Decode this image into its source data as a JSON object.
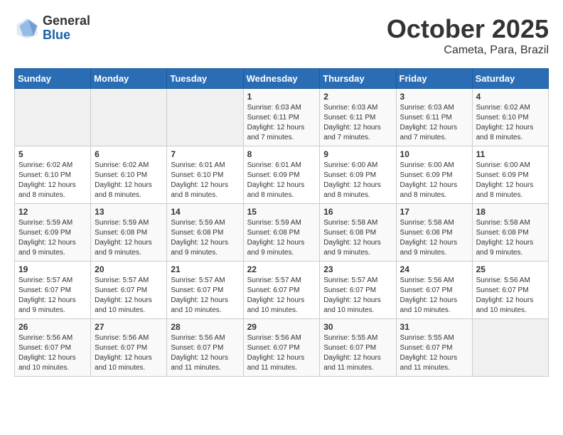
{
  "header": {
    "logo_general": "General",
    "logo_blue": "Blue",
    "month_title": "October 2025",
    "location": "Cameta, Para, Brazil"
  },
  "weekdays": [
    "Sunday",
    "Monday",
    "Tuesday",
    "Wednesday",
    "Thursday",
    "Friday",
    "Saturday"
  ],
  "weeks": [
    [
      {
        "day": "",
        "content": ""
      },
      {
        "day": "",
        "content": ""
      },
      {
        "day": "",
        "content": ""
      },
      {
        "day": "1",
        "content": "Sunrise: 6:03 AM\nSunset: 6:11 PM\nDaylight: 12 hours and 7 minutes."
      },
      {
        "day": "2",
        "content": "Sunrise: 6:03 AM\nSunset: 6:11 PM\nDaylight: 12 hours and 7 minutes."
      },
      {
        "day": "3",
        "content": "Sunrise: 6:03 AM\nSunset: 6:11 PM\nDaylight: 12 hours and 7 minutes."
      },
      {
        "day": "4",
        "content": "Sunrise: 6:02 AM\nSunset: 6:10 PM\nDaylight: 12 hours and 8 minutes."
      }
    ],
    [
      {
        "day": "5",
        "content": "Sunrise: 6:02 AM\nSunset: 6:10 PM\nDaylight: 12 hours and 8 minutes."
      },
      {
        "day": "6",
        "content": "Sunrise: 6:02 AM\nSunset: 6:10 PM\nDaylight: 12 hours and 8 minutes."
      },
      {
        "day": "7",
        "content": "Sunrise: 6:01 AM\nSunset: 6:10 PM\nDaylight: 12 hours and 8 minutes."
      },
      {
        "day": "8",
        "content": "Sunrise: 6:01 AM\nSunset: 6:09 PM\nDaylight: 12 hours and 8 minutes."
      },
      {
        "day": "9",
        "content": "Sunrise: 6:00 AM\nSunset: 6:09 PM\nDaylight: 12 hours and 8 minutes."
      },
      {
        "day": "10",
        "content": "Sunrise: 6:00 AM\nSunset: 6:09 PM\nDaylight: 12 hours and 8 minutes."
      },
      {
        "day": "11",
        "content": "Sunrise: 6:00 AM\nSunset: 6:09 PM\nDaylight: 12 hours and 8 minutes."
      }
    ],
    [
      {
        "day": "12",
        "content": "Sunrise: 5:59 AM\nSunset: 6:09 PM\nDaylight: 12 hours and 9 minutes."
      },
      {
        "day": "13",
        "content": "Sunrise: 5:59 AM\nSunset: 6:08 PM\nDaylight: 12 hours and 9 minutes."
      },
      {
        "day": "14",
        "content": "Sunrise: 5:59 AM\nSunset: 6:08 PM\nDaylight: 12 hours and 9 minutes."
      },
      {
        "day": "15",
        "content": "Sunrise: 5:59 AM\nSunset: 6:08 PM\nDaylight: 12 hours and 9 minutes."
      },
      {
        "day": "16",
        "content": "Sunrise: 5:58 AM\nSunset: 6:08 PM\nDaylight: 12 hours and 9 minutes."
      },
      {
        "day": "17",
        "content": "Sunrise: 5:58 AM\nSunset: 6:08 PM\nDaylight: 12 hours and 9 minutes."
      },
      {
        "day": "18",
        "content": "Sunrise: 5:58 AM\nSunset: 6:08 PM\nDaylight: 12 hours and 9 minutes."
      }
    ],
    [
      {
        "day": "19",
        "content": "Sunrise: 5:57 AM\nSunset: 6:07 PM\nDaylight: 12 hours and 9 minutes."
      },
      {
        "day": "20",
        "content": "Sunrise: 5:57 AM\nSunset: 6:07 PM\nDaylight: 12 hours and 10 minutes."
      },
      {
        "day": "21",
        "content": "Sunrise: 5:57 AM\nSunset: 6:07 PM\nDaylight: 12 hours and 10 minutes."
      },
      {
        "day": "22",
        "content": "Sunrise: 5:57 AM\nSunset: 6:07 PM\nDaylight: 12 hours and 10 minutes."
      },
      {
        "day": "23",
        "content": "Sunrise: 5:57 AM\nSunset: 6:07 PM\nDaylight: 12 hours and 10 minutes."
      },
      {
        "day": "24",
        "content": "Sunrise: 5:56 AM\nSunset: 6:07 PM\nDaylight: 12 hours and 10 minutes."
      },
      {
        "day": "25",
        "content": "Sunrise: 5:56 AM\nSunset: 6:07 PM\nDaylight: 12 hours and 10 minutes."
      }
    ],
    [
      {
        "day": "26",
        "content": "Sunrise: 5:56 AM\nSunset: 6:07 PM\nDaylight: 12 hours and 10 minutes."
      },
      {
        "day": "27",
        "content": "Sunrise: 5:56 AM\nSunset: 6:07 PM\nDaylight: 12 hours and 10 minutes."
      },
      {
        "day": "28",
        "content": "Sunrise: 5:56 AM\nSunset: 6:07 PM\nDaylight: 12 hours and 11 minutes."
      },
      {
        "day": "29",
        "content": "Sunrise: 5:56 AM\nSunset: 6:07 PM\nDaylight: 12 hours and 11 minutes."
      },
      {
        "day": "30",
        "content": "Sunrise: 5:55 AM\nSunset: 6:07 PM\nDaylight: 12 hours and 11 minutes."
      },
      {
        "day": "31",
        "content": "Sunrise: 5:55 AM\nSunset: 6:07 PM\nDaylight: 12 hours and 11 minutes."
      },
      {
        "day": "",
        "content": ""
      }
    ]
  ]
}
